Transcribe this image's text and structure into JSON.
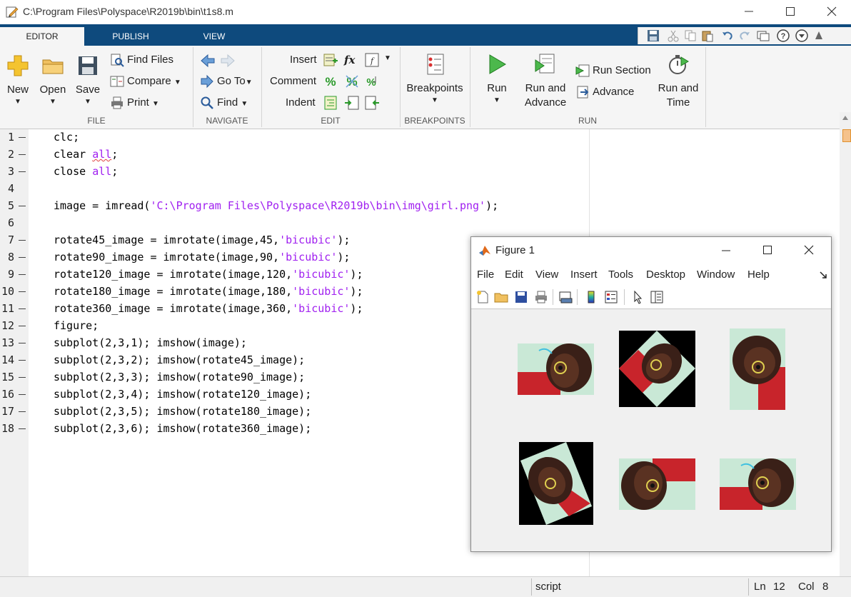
{
  "window": {
    "title": "C:\\Program Files\\Polyspace\\R2019b\\bin\\t1s8.m"
  },
  "tabs": [
    "EDITOR",
    "PUBLISH",
    "VIEW"
  ],
  "ribbon": {
    "file": {
      "label": "FILE",
      "new": "New",
      "open": "Open",
      "save": "Save",
      "find_files": "Find Files",
      "compare": "Compare",
      "print": "Print"
    },
    "navigate": {
      "label": "NAVIGATE",
      "go_to": "Go To",
      "find": "Find"
    },
    "edit": {
      "label": "EDIT",
      "insert": "Insert",
      "comment": "Comment",
      "indent": "Indent",
      "fx": "fx"
    },
    "breakpoints": {
      "label": "BREAKPOINTS",
      "breakpoints": "Breakpoints"
    },
    "run": {
      "label": "RUN",
      "run": "Run",
      "run_and_advance_1": "Run and",
      "run_and_advance_2": "Advance",
      "run_section": "Run Section",
      "advance": "Advance",
      "run_and_time_1": "Run and",
      "run_and_time_2": "Time"
    }
  },
  "editor": {
    "line_numbers": [
      "1",
      "2",
      "3",
      "4",
      "5",
      "6",
      "7",
      "8",
      "9",
      "10",
      "11",
      "12",
      "13",
      "14",
      "15",
      "16",
      "17",
      "18"
    ],
    "lines": {
      "l1": "clc;",
      "l2_a": "clear ",
      "l2_b": "all",
      "l2_c": ";",
      "l3_a": "close ",
      "l3_b": "all",
      "l3_c": ";",
      "l5_a": "image = imread(",
      "l5_b": "'C:\\Program Files\\Polyspace\\R2019b\\bin\\img\\girl.png'",
      "l5_c": ");",
      "l7_a": "rotate45_image = imrotate(image,45,",
      "l7_b": "'bicubic'",
      "l7_c": ");",
      "l8_a": "rotate90_image = imrotate(image,90,",
      "l8_b": "'bicubic'",
      "l8_c": ");",
      "l9_a": "rotate120_image = imrotate(image,120,",
      "l9_b": "'bicubic'",
      "l9_c": ");",
      "l10_a": "rotate180_image = imrotate(image,180,",
      "l10_b": "'bicubic'",
      "l10_c": ");",
      "l11_a": "rotate360_image = imrotate(image,360,",
      "l11_b": "'bicubic'",
      "l11_c": ");",
      "l12": "figure;",
      "l13": "subplot(2,3,1); imshow(image);",
      "l14": "subplot(2,3,2); imshow(rotate45_image);",
      "l15": "subplot(2,3,3); imshow(rotate90_image);",
      "l16": "subplot(2,3,4); imshow(rotate120_image);",
      "l17": "subplot(2,3,5); imshow(rotate180_image);",
      "l18": "subplot(2,3,6); imshow(rotate360_image);"
    }
  },
  "statusbar": {
    "mode": "script",
    "ln_label": "Ln",
    "ln_value": "12",
    "col_label": "Col",
    "col_value": "8"
  },
  "figure": {
    "title": "Figure 1",
    "menu": [
      "File",
      "Edit",
      "View",
      "Insert",
      "Tools",
      "Desktop",
      "Window",
      "Help"
    ]
  },
  "colors": {
    "tab_strip": "#0e4a7d",
    "string": "#a020f0"
  }
}
